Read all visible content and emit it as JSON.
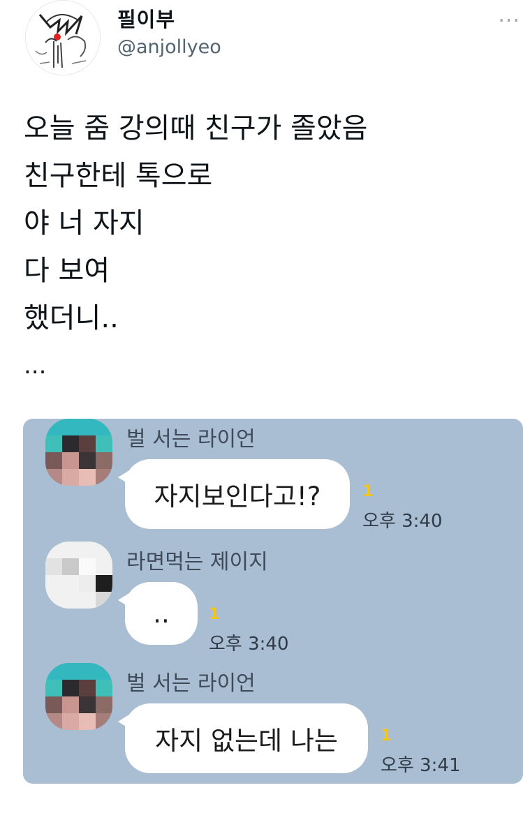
{
  "profile": {
    "display_name": "필이부",
    "handle": "@anjollyeo",
    "more_icon": "more-horizontal-icon",
    "more_text": "..."
  },
  "tweet": {
    "lines": [
      "오늘 줌 강의때 친구가 졸았음",
      "친구한테 톡으로",
      "야 너 자지",
      "다 보여",
      "했더니..",
      "..."
    ]
  },
  "chat": {
    "background": "#a9bdd3",
    "messages": [
      {
        "sender": "벌 서는 라이언",
        "text": "자지보인다고!?",
        "unread": "1",
        "time": "오후 3:40"
      },
      {
        "sender": "라면먹는 제이지",
        "text": "..",
        "unread": "1",
        "time": "오후 3:40"
      },
      {
        "sender": "벌 서는 라이언",
        "text": "자지 없는데 나는",
        "unread": "1",
        "time": "오후 3:41"
      }
    ]
  }
}
